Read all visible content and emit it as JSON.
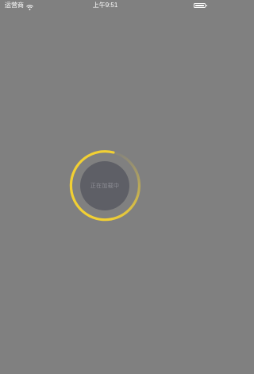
{
  "status_bar": {
    "carrier": "运营商",
    "time": "上午9:51",
    "wifi_icon": "wifi-icon",
    "battery_icon": "battery-icon"
  },
  "loader": {
    "label": "正在加载中",
    "spinner_icon": "loading-spinner-icon",
    "accent_color": "#f2d033",
    "disc_color": "#5e5f66"
  }
}
